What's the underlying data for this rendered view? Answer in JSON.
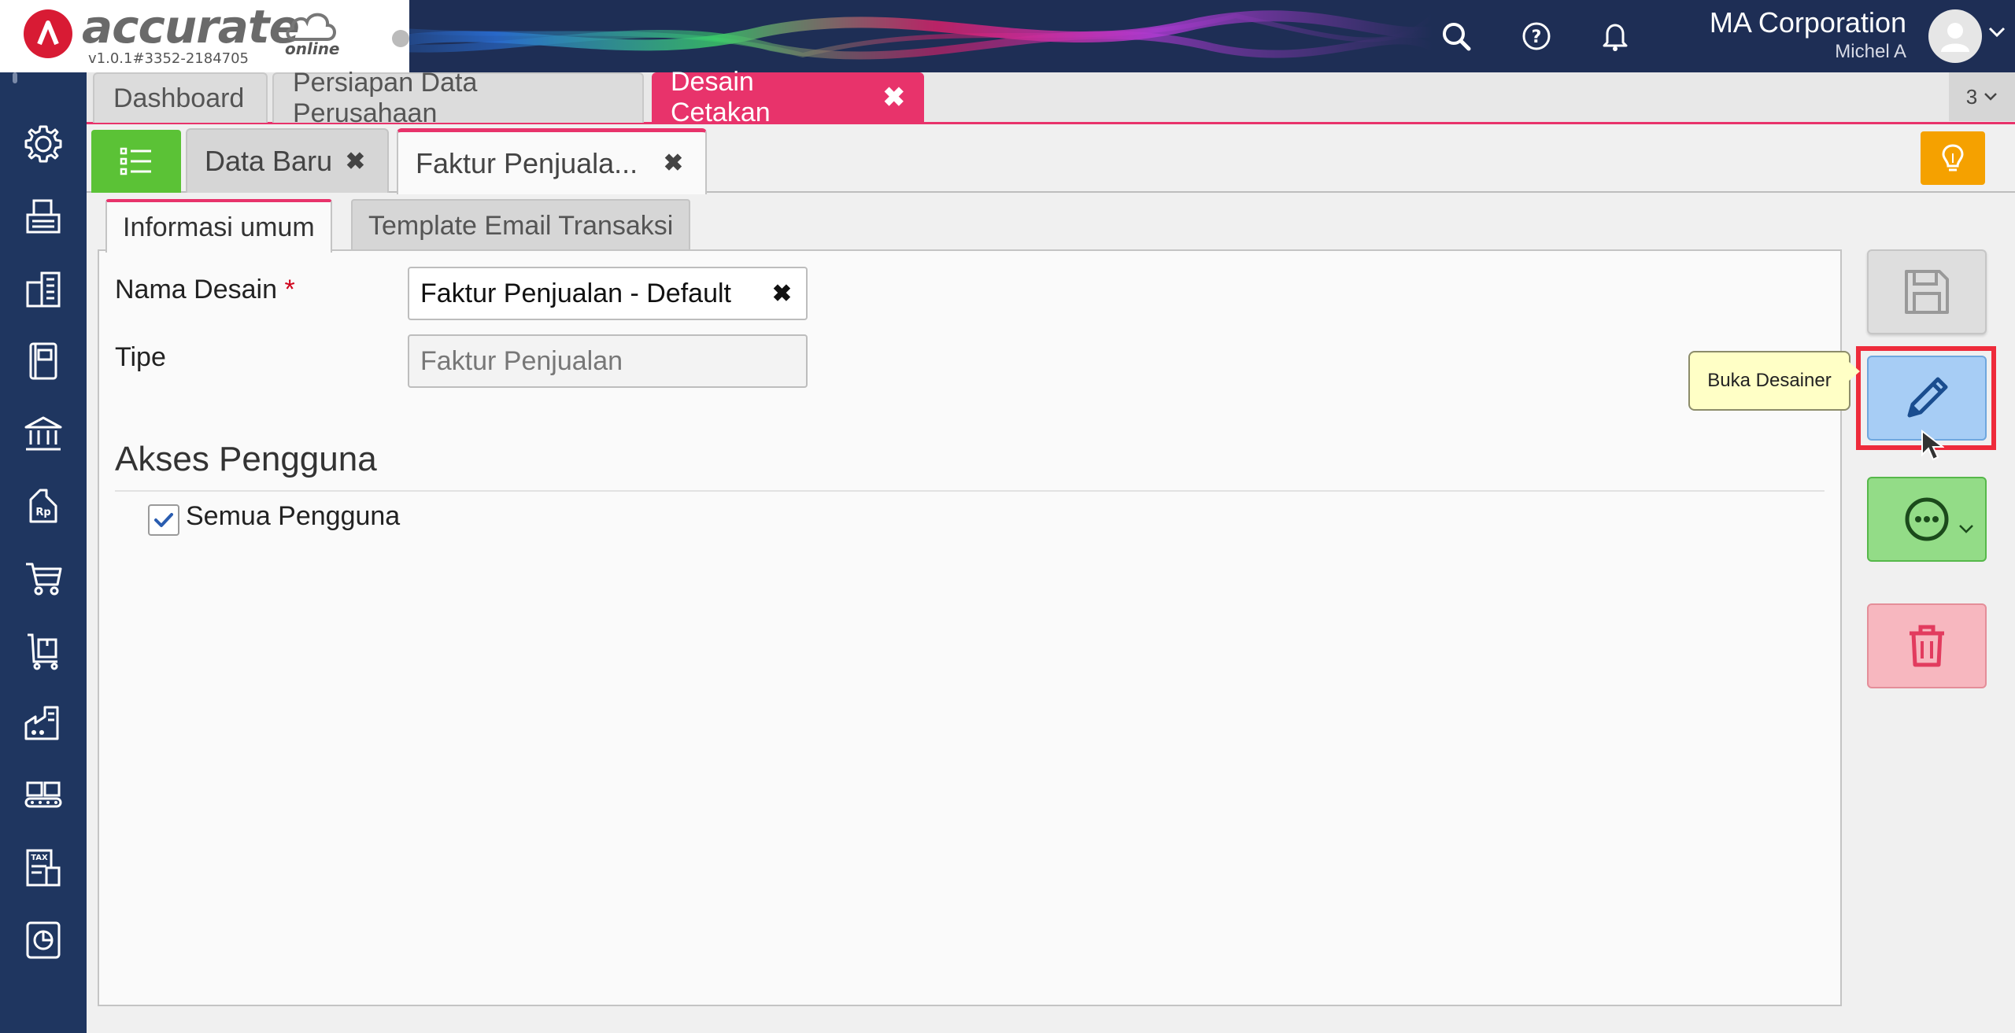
{
  "header": {
    "logo_text": "accurate",
    "logo_sub": "online",
    "version": "v1.0.1#3352-2184705",
    "company_name": "MA Corporation",
    "user_name": "Michel A",
    "icons": [
      "search-icon",
      "help-icon",
      "bell-icon"
    ]
  },
  "sidebar": {
    "icons": [
      "gear-icon",
      "fax-icon",
      "building-icon",
      "ledger-icon",
      "bank-icon",
      "rp-tag-icon",
      "cart-icon",
      "trolley-icon",
      "factory-icon",
      "warehouse-icon",
      "tax-icon",
      "report-icon"
    ]
  },
  "top_tabs": [
    {
      "label": "Dashboard",
      "active": false
    },
    {
      "label": "Persiapan Data Perusahaan",
      "active": false
    },
    {
      "label": "Desain Cetakan",
      "active": true,
      "close": "✖"
    }
  ],
  "tab_count": "3",
  "sub_tabs": [
    {
      "label": "Data Baru",
      "close": "✖",
      "active": false
    },
    {
      "label": "Faktur Penjuala...",
      "close": "✖",
      "active": true
    }
  ],
  "inner_tabs": [
    {
      "label": "Informasi umum",
      "active": true
    },
    {
      "label": "Template Email Transaksi",
      "active": false
    }
  ],
  "form": {
    "nama_desain_label": "Nama Desain",
    "required_mark": "*",
    "nama_desain_value": "Faktur Penjualan - Default",
    "clear_glyph": "✖",
    "tipe_label": "Tipe",
    "tipe_placeholder": "Faktur Penjualan",
    "section_title": "Akses Pengguna",
    "semua_pengguna_label": "Semua Pengguna",
    "semua_pengguna_checked": true
  },
  "actions": {
    "tooltip": "Buka Desainer",
    "buttons": [
      "save-button",
      "open-designer-button",
      "more-options-button",
      "delete-button"
    ]
  },
  "colors": {
    "header_bg": "#1e2e55",
    "sidebar_bg": "#1f3660",
    "accent_pink": "#e8336b",
    "list_green": "#5bc236",
    "bulb_orange": "#f5a100",
    "edit_blue": "#a7cdf5",
    "more_green": "#93dc87",
    "delete_pink": "#f7b7bf",
    "highlight_red": "#ee2b3b"
  }
}
